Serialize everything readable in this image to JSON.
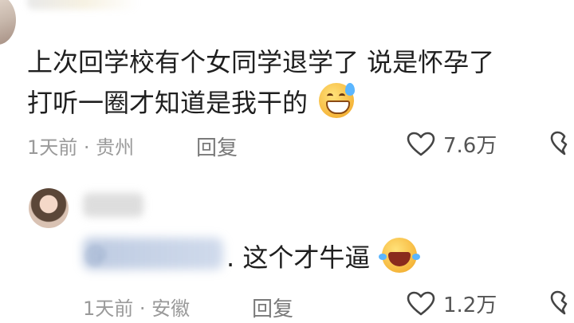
{
  "comments": [
    {
      "text_line1": "上次回学校有个女同学退学了 说是怀孕了",
      "text_line2": "打听一圈才知道是我干的",
      "meta": "1天前 · 贵州",
      "reply_label": "回复",
      "likes": "7.6万"
    },
    {
      "mention": "@",
      "text": ". 这个才牛逼",
      "meta": "1天前 · 安徽",
      "reply_label": "回复",
      "likes": "1.2万"
    }
  ],
  "colors": {
    "text": "#1f1f1f",
    "meta": "#9a9a9a",
    "icon": "#444444"
  },
  "icons": [
    "heart-outline-icon",
    "broken-heart-icon",
    "grin-sweat-emoji",
    "laugh-tears-emoji"
  ]
}
